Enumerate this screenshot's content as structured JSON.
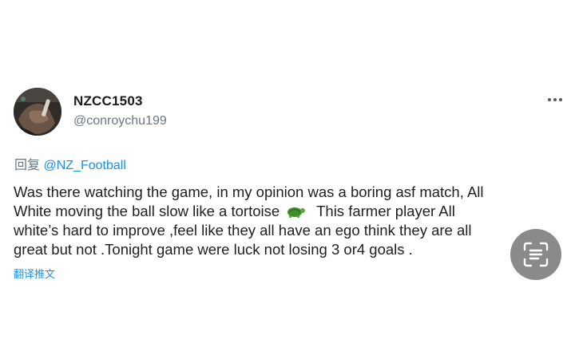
{
  "tweet": {
    "display_name": "NZCC1503",
    "handle": "@conroychu199",
    "reply_prefix": "回复",
    "reply_mention": "@NZ_Football",
    "body_lines": [
      "Was there watching the game, in my opinion was a boring asf match, All",
      "White moving the ball slow like a tortoise",
      "This farmer player All",
      "white’s hard to improve ,feel like they all have an ego think they are all",
      "great but not .Tonight game  were luck not losing  3 or4 goals ."
    ],
    "translate_label": "翻译推文"
  },
  "icons": {
    "more": "more-horizontal-icon",
    "emoji": "turtle-emoji-icon",
    "scan": "text-scan-icon"
  },
  "colors": {
    "link": "#1d8fe0",
    "secondary_text": "#6b7680",
    "scan_button": "#8a8a8a"
  }
}
